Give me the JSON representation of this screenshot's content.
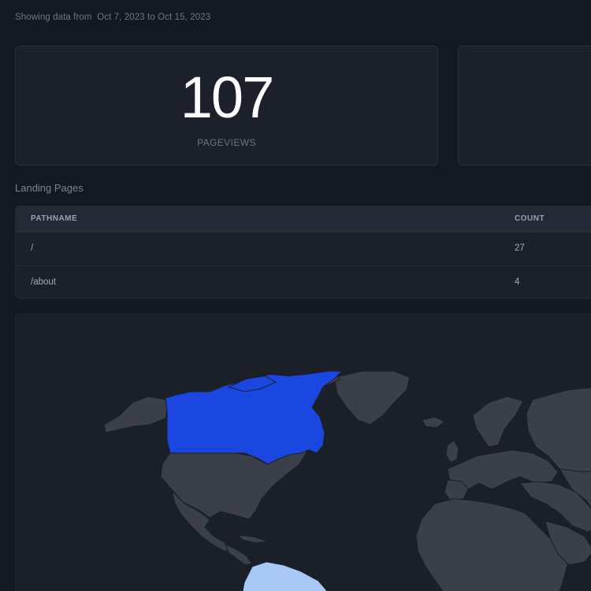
{
  "date_range": {
    "prefix": "Showing data from",
    "start": "Oct 7, 2023",
    "connector": "to",
    "end": "Oct 15, 2023"
  },
  "stats": {
    "pageviews": {
      "value": "107",
      "label": "PAGEVIEWS"
    }
  },
  "landing_pages": {
    "title": "Landing Pages",
    "columns": [
      "PATHNAME",
      "COUNT"
    ],
    "rows": [
      {
        "pathname": "/",
        "count": "27"
      },
      {
        "pathname": "/about",
        "count": "4"
      }
    ]
  },
  "map": {
    "land_color": "#3a3f49",
    "border_color": "#1b1f28",
    "highlight_colors": {
      "high": "#1a47e0",
      "low": "#a9c8f5"
    },
    "highlighted_countries": [
      {
        "name": "canada",
        "level": "high"
      },
      {
        "name": "south-america",
        "level": "low"
      }
    ]
  }
}
